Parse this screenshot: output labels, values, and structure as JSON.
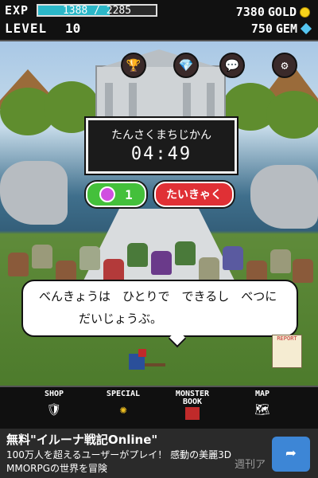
{
  "hud": {
    "exp_label": "EXP",
    "exp_text": "1388 / 2285",
    "exp_progress": 0.6075,
    "level_label": "LEVEL",
    "level_value": "10",
    "gold_value": "7380",
    "gold_label": "GOLD",
    "gem_value": "750",
    "gem_label": "GEM"
  },
  "scene_icons": {
    "trophy": "trophy-icon",
    "diamond": "diamond-icon",
    "chat": "chat-icon",
    "settings": "gear-icon"
  },
  "wait": {
    "title": "たんさくまちじかん",
    "timer": "04:49"
  },
  "buttons": {
    "potion_count": "1",
    "retreat": "たいきゃく"
  },
  "dialog": {
    "line1": "べんきょうは　ひとりで　できるし　べつに",
    "line2": "だいじょうぶ。"
  },
  "report_label": "REPORT",
  "menu": {
    "items": [
      {
        "label": "SHOP",
        "icon": "shield-icon"
      },
      {
        "label": "SPECIAL",
        "icon": "sun-emblem-icon"
      },
      {
        "label": "MONSTER\nBOOK",
        "icon": "book-icon"
      },
      {
        "label": "MAP",
        "icon": "map-icon"
      }
    ]
  },
  "ad": {
    "headline": "無料\"イルーナ戦記Online\"",
    "line1": "100万人を超えるユーザーがプレイ！ 感動の美麗3D",
    "line2": "MMORPGの世界を冒険",
    "watermark": "週刊ア"
  },
  "colors": {
    "exp_bar": "#2bb7c8",
    "gold": "#f7d21a",
    "gem": "#55c6f2",
    "green_button": "#44c03b",
    "red_button": "#e03035"
  }
}
